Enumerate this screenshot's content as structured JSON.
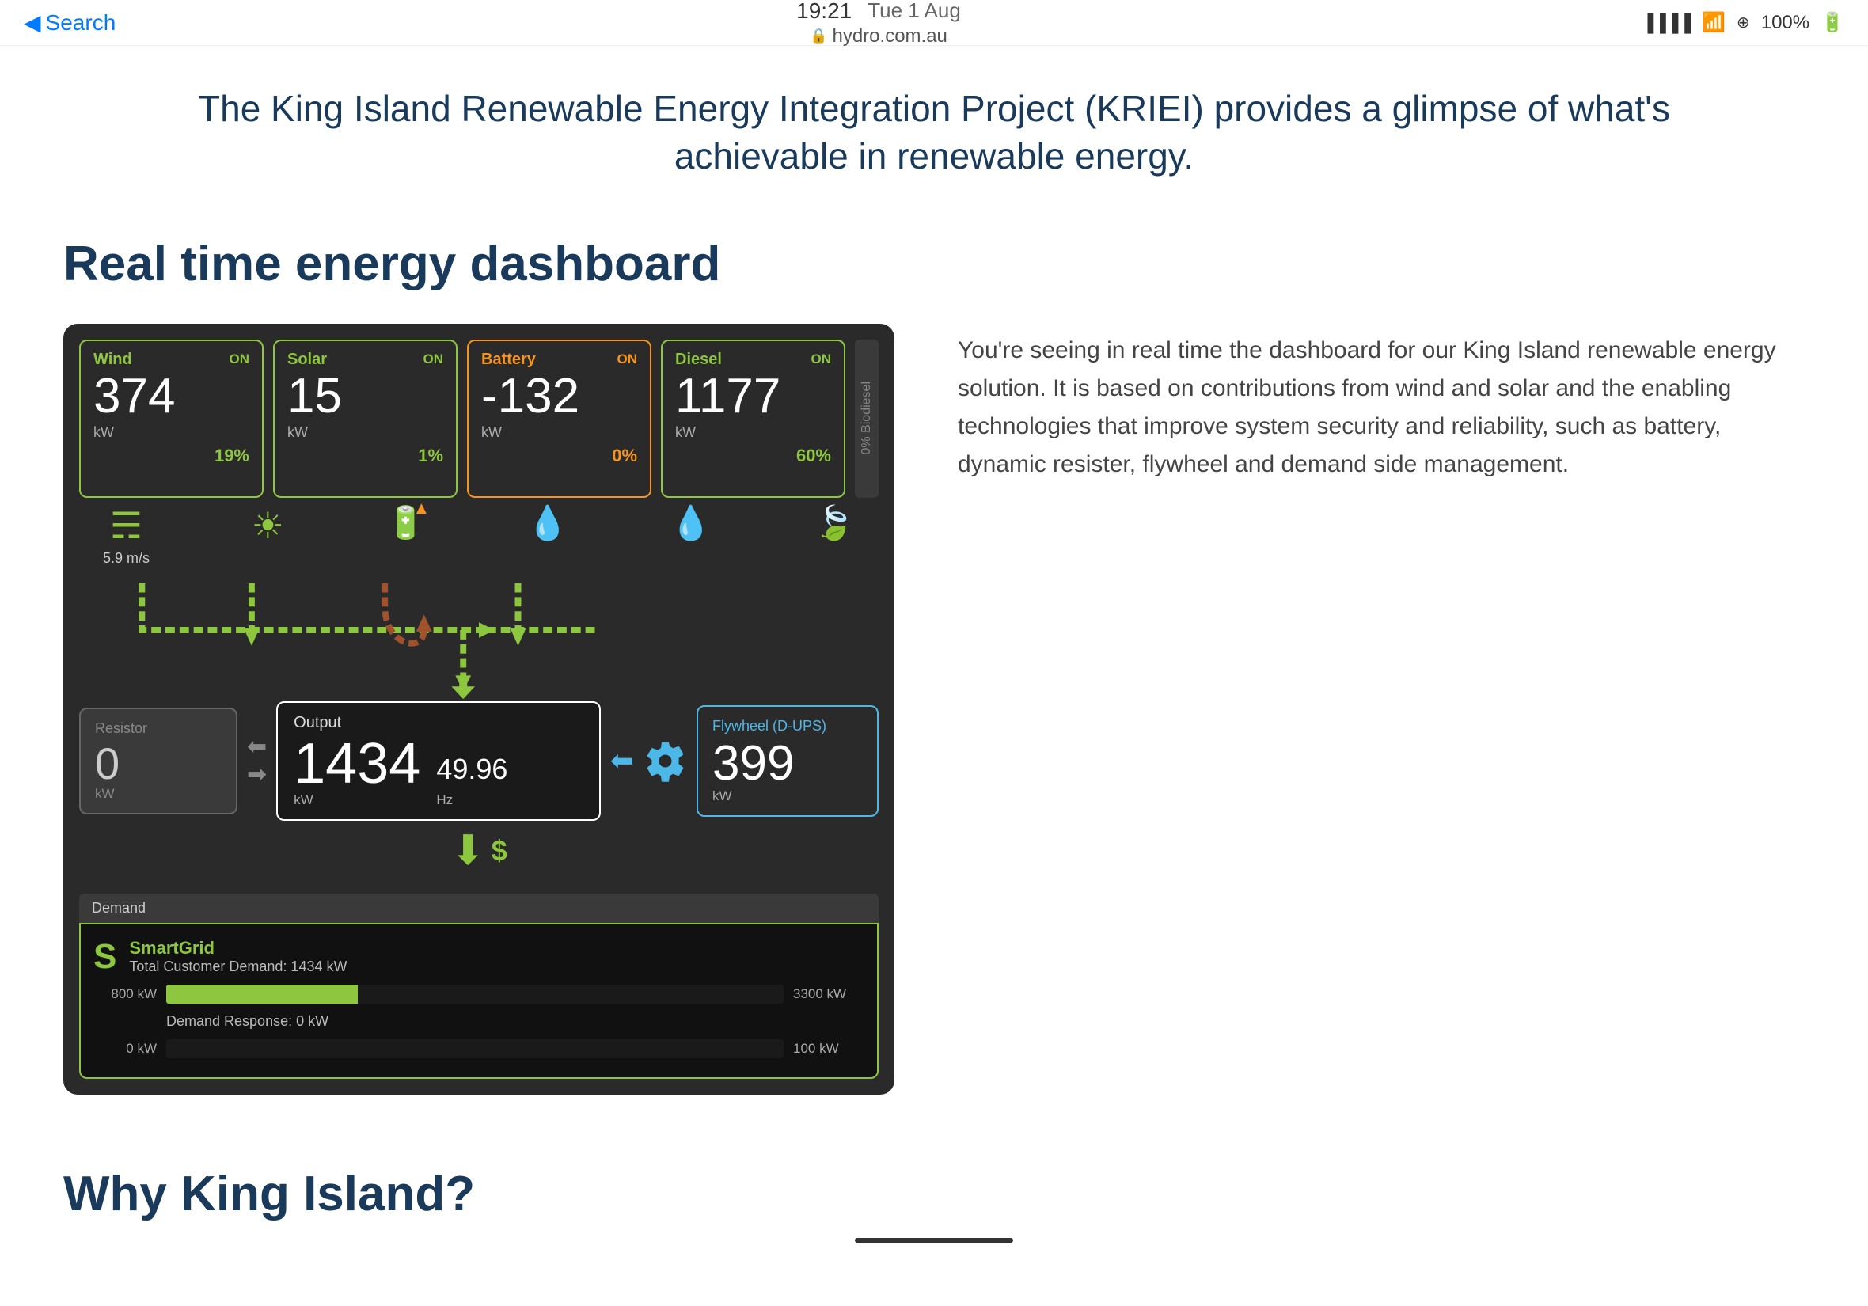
{
  "status_bar": {
    "back_label": "Search",
    "time": "19:21",
    "date": "Tue 1 Aug",
    "url": "hydro.com.au",
    "signal": "●●●●",
    "wifi": "wifi",
    "battery_percent": "100%"
  },
  "hero_text": "The King Island Renewable Energy Integration Project (KRIEI) provides a glimpse of what's achievable in renewable energy.",
  "section": {
    "heading": "Real time energy dashboard"
  },
  "energy_sources": [
    {
      "id": "wind",
      "label": "Wind",
      "status": "ON",
      "color_class": "green",
      "value": "374",
      "unit": "kW",
      "percent": "19%"
    },
    {
      "id": "solar",
      "label": "Solar",
      "status": "ON",
      "color_class": "green",
      "value": "15",
      "unit": "kW",
      "percent": "1%"
    },
    {
      "id": "battery",
      "label": "Battery",
      "status": "ON",
      "color_class": "orange",
      "value": "-132",
      "unit": "kW",
      "percent": "0%"
    },
    {
      "id": "diesel",
      "label": "Diesel",
      "status": "ON",
      "color_class": "green",
      "value": "1177",
      "unit": "kW",
      "percent": "60%"
    }
  ],
  "biodiesel": {
    "label": "0% Biodiesel"
  },
  "flow": {
    "wind_speed": "5.9 m/s",
    "icons": [
      "wind",
      "solar",
      "battery",
      "diesel",
      "water_drop",
      "leaf"
    ]
  },
  "resistor": {
    "label": "Resistor",
    "value": "0",
    "unit": "kW"
  },
  "output": {
    "label": "Output",
    "value": "1434",
    "unit": "kW",
    "freq_value": "49.96",
    "freq_unit": "Hz"
  },
  "flywheel": {
    "label": "Flywheel (D-UPS)",
    "value": "399",
    "unit": "kW"
  },
  "demand": {
    "header": "Demand",
    "smartgrid_title": "SmartGrid",
    "total_demand": "Total Customer Demand: 1434 kW",
    "bar1_min": "800 kW",
    "bar1_max": "3300 kW",
    "bar1_fill_pct": 31,
    "demand_response_label": "Demand Response: 0 kW",
    "bar2_min": "0 kW",
    "bar2_max": "100 kW",
    "bar2_fill_pct": 0
  },
  "description": "You're seeing in real time the dashboard for our King Island renewable energy solution. It is based on contributions from wind and solar and the enabling technologies that improve system security and reliability, such as battery, dynamic resister, flywheel and demand side management.",
  "why_section": {
    "heading": "Why King Island?"
  }
}
